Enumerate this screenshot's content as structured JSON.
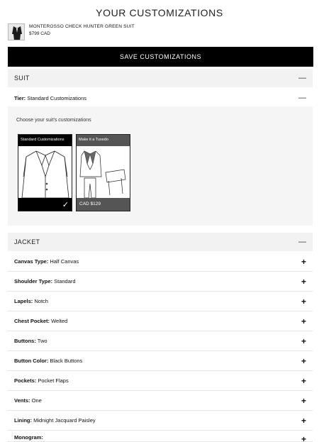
{
  "page_title": "YOUR CUSTOMIZATIONS",
  "product": {
    "name": "MONTEROSSO CHECK HUNTER GREEN SUIT",
    "price": "$799 CAD"
  },
  "save_button": "SAVE CUSTOMIZATIONS",
  "suit_section": {
    "label": "SUIT",
    "tier": {
      "key": "Tier:",
      "value": "Standard Customizations"
    },
    "prompt": "Choose your suit's customizations",
    "cards": [
      {
        "title": "Standard Customizations",
        "footer": "",
        "selected": true
      },
      {
        "title": "Make it a Tuxedo",
        "footer": "CAD $129",
        "selected": false
      }
    ]
  },
  "jacket_section": {
    "label": "JACKET",
    "options": [
      {
        "key": "Canvas Type:",
        "value": "Half Canvas"
      },
      {
        "key": "Shoulder Type:",
        "value": "Standard"
      },
      {
        "key": "Lapels:",
        "value": "Notch"
      },
      {
        "key": "Chest Pocket:",
        "value": "Welted"
      },
      {
        "key": "Buttons:",
        "value": "Two"
      },
      {
        "key": "Button Color:",
        "value": "Black Buttons"
      },
      {
        "key": "Pockets:",
        "value": "Pocket Flaps"
      },
      {
        "key": "Vents:",
        "value": "One"
      },
      {
        "key": "Lining:",
        "value": "Midnight Jacquard Paisley"
      },
      {
        "key": "Monogram:",
        "value": ""
      }
    ]
  },
  "icons": {
    "collapse": "minus-icon",
    "expand": "plus-icon",
    "selected": "checkmark-icon"
  }
}
